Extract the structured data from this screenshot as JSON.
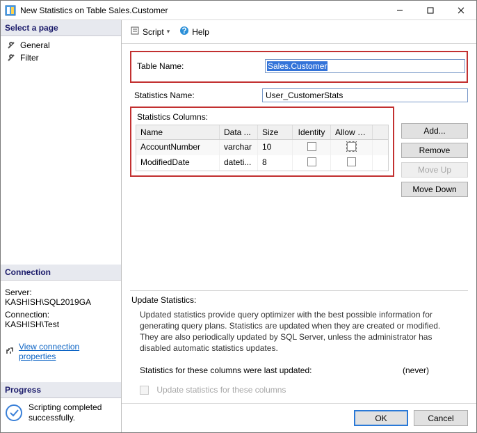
{
  "window": {
    "title": "New Statistics on Table Sales.Customer",
    "min": "—",
    "max": "▢",
    "close": "✕"
  },
  "left": {
    "select_page": "Select a page",
    "pages": {
      "general": "General",
      "filter": "Filter"
    },
    "connection_hdr": "Connection",
    "server_lbl": "Server:",
    "server_val": "KASHISH\\SQL2019GA",
    "conn_lbl": "Connection:",
    "conn_val": "KASHISH\\Test",
    "view_conn": "View connection properties",
    "progress_hdr": "Progress",
    "progress_msg": "Scripting completed successfully."
  },
  "toolbar": {
    "script": "Script",
    "help": "Help"
  },
  "form": {
    "table_name_lbl": "Table Name:",
    "table_name_val": "Sales.Customer",
    "stats_name_lbl": "Statistics Name:",
    "stats_name_val": "User_CustomerStats",
    "stats_cols_lbl": "Statistics Columns:"
  },
  "grid": {
    "headers": {
      "name": "Name",
      "data": "Data ...",
      "size": "Size",
      "identity": "Identity",
      "allown": "Allow N..."
    },
    "rows": [
      {
        "name": "AccountNumber",
        "data": "varchar",
        "size": "10",
        "identity": false,
        "allown": false
      },
      {
        "name": "ModifiedDate",
        "data": "dateti...",
        "size": "8",
        "identity": false,
        "allown": false
      }
    ]
  },
  "buttons": {
    "add": "Add...",
    "remove": "Remove",
    "moveup": "Move Up",
    "movedown": "Move Down"
  },
  "update": {
    "hdr": "Update Statistics:",
    "desc": "Updated statistics provide query optimizer with the best possible information for generating query plans. Statistics are updated when they are created or modified. They are also periodically updated by SQL Server, unless the administrator has disabled automatic statistics updates.",
    "last_lbl": "Statistics for these columns were last updated:",
    "last_val": "(never)",
    "checkbox_lbl": "Update statistics for these columns"
  },
  "footer": {
    "ok": "OK",
    "cancel": "Cancel"
  }
}
